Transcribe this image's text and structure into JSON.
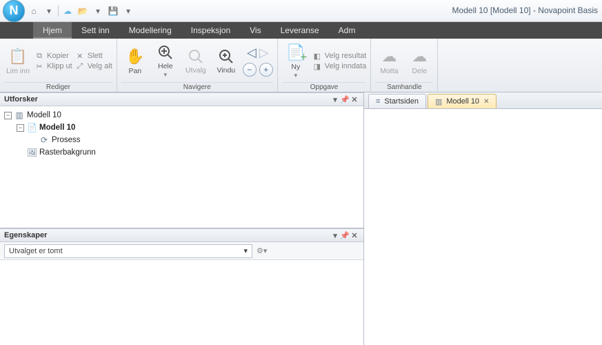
{
  "title": "Modell 10 [Modell 10] - Novapoint Basis",
  "app_letter": "N",
  "menu": {
    "items": [
      {
        "label": "Hjem",
        "active": true
      },
      {
        "label": "Sett inn",
        "active": false
      },
      {
        "label": "Modellering",
        "active": false
      },
      {
        "label": "Inspeksjon",
        "active": false
      },
      {
        "label": "Vis",
        "active": false
      },
      {
        "label": "Leveranse",
        "active": false
      },
      {
        "label": "Adm",
        "active": false
      }
    ]
  },
  "ribbon": {
    "groups": [
      {
        "title": "Rediger",
        "primary": {
          "label": "Lim inn",
          "icon": "paste"
        },
        "items": [
          {
            "label": "Kopier",
            "icon": "copy"
          },
          {
            "label": "Klipp ut",
            "icon": "cut"
          },
          {
            "label": "Slett",
            "icon": "delete"
          },
          {
            "label": "Velg alt",
            "icon": "selectall"
          }
        ]
      },
      {
        "title": "Navigere",
        "buttons": [
          {
            "label": "Pan",
            "icon": "hand"
          },
          {
            "label": "Hele",
            "icon": "zoomfit"
          },
          {
            "label": "Utvalg",
            "icon": "zoomsel"
          },
          {
            "label": "Vindu",
            "icon": "zoomwin"
          }
        ]
      },
      {
        "title": "Oppgave",
        "primary": {
          "label": "Ny",
          "icon": "newtask"
        },
        "items": [
          {
            "label": "Velg resultat",
            "icon": "result"
          },
          {
            "label": "Velg inndata",
            "icon": "input"
          }
        ]
      },
      {
        "title": "Samhandle",
        "buttons": [
          {
            "label": "Motta",
            "icon": "cloud-down"
          },
          {
            "label": "Dele",
            "icon": "cloud-up"
          }
        ]
      }
    ]
  },
  "panels": {
    "explorer": {
      "title": "Utforsker"
    },
    "properties": {
      "title": "Egenskaper",
      "selected": "Utvalget er tomt"
    }
  },
  "tree": {
    "root": {
      "label": "Modell 10"
    },
    "children": [
      {
        "label": "Modell 10",
        "bold": true,
        "icon": "doc",
        "children": [
          {
            "label": "Prosess",
            "icon": "process"
          }
        ]
      },
      {
        "label": "Rasterbakgrunn",
        "icon": "raster"
      }
    ]
  },
  "docs": {
    "tabs": [
      {
        "label": "Startsiden",
        "active": false,
        "closable": false
      },
      {
        "label": "Modell 10",
        "active": true,
        "closable": true
      }
    ]
  }
}
